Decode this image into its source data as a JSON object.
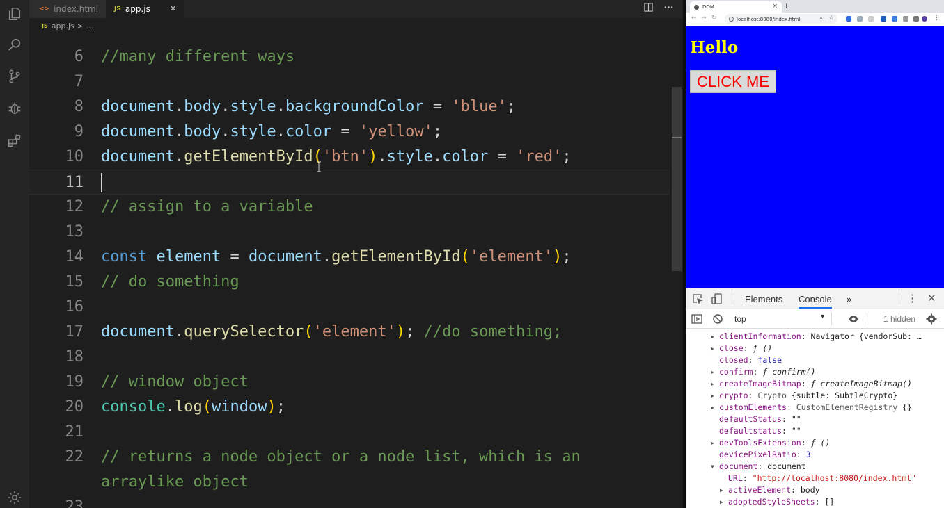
{
  "editor": {
    "tabs": [
      {
        "label": "index.html",
        "glyph": "<>"
      },
      {
        "label": "app.js",
        "glyph": "JS"
      }
    ],
    "tab_close": "×",
    "breadcrumb": {
      "glyph": "JS",
      "file": "app.js",
      "sep": ">",
      "rest": "..."
    },
    "lines": [
      {
        "num": "6",
        "tokens": [
          {
            "t": "//many different ways",
            "c": "comment"
          }
        ]
      },
      {
        "num": "7",
        "tokens": []
      },
      {
        "num": "8",
        "tokens": [
          {
            "t": "document",
            "c": "var"
          },
          {
            "t": ".",
            "c": "plain"
          },
          {
            "t": "body",
            "c": "var"
          },
          {
            "t": ".",
            "c": "plain"
          },
          {
            "t": "style",
            "c": "var"
          },
          {
            "t": ".",
            "c": "plain"
          },
          {
            "t": "backgroundColor",
            "c": "var"
          },
          {
            "t": " = ",
            "c": "plain"
          },
          {
            "t": "'blue'",
            "c": "str"
          },
          {
            "t": ";",
            "c": "plain"
          }
        ]
      },
      {
        "num": "9",
        "tokens": [
          {
            "t": "document",
            "c": "var"
          },
          {
            "t": ".",
            "c": "plain"
          },
          {
            "t": "body",
            "c": "var"
          },
          {
            "t": ".",
            "c": "plain"
          },
          {
            "t": "style",
            "c": "var"
          },
          {
            "t": ".",
            "c": "plain"
          },
          {
            "t": "color",
            "c": "var"
          },
          {
            "t": " = ",
            "c": "plain"
          },
          {
            "t": "'yellow'",
            "c": "str"
          },
          {
            "t": ";",
            "c": "plain"
          }
        ]
      },
      {
        "num": "10",
        "tokens": [
          {
            "t": "document",
            "c": "var"
          },
          {
            "t": ".",
            "c": "plain"
          },
          {
            "t": "getElementById",
            "c": "fn"
          },
          {
            "t": "(",
            "c": "brk"
          },
          {
            "t": "'btn'",
            "c": "str"
          },
          {
            "t": ")",
            "c": "brk"
          },
          {
            "t": ".",
            "c": "plain"
          },
          {
            "t": "style",
            "c": "var"
          },
          {
            "t": ".",
            "c": "plain"
          },
          {
            "t": "color",
            "c": "var"
          },
          {
            "t": " = ",
            "c": "plain"
          },
          {
            "t": "'red'",
            "c": "str"
          },
          {
            "t": ";",
            "c": "plain"
          }
        ]
      },
      {
        "num": "11",
        "tokens": [],
        "current": true
      },
      {
        "num": "12",
        "tokens": [
          {
            "t": "// assign to a variable",
            "c": "comment"
          }
        ]
      },
      {
        "num": "13",
        "tokens": []
      },
      {
        "num": "14",
        "tokens": [
          {
            "t": "const",
            "c": "kw"
          },
          {
            "t": " ",
            "c": "plain"
          },
          {
            "t": "element",
            "c": "var"
          },
          {
            "t": " = ",
            "c": "plain"
          },
          {
            "t": "document",
            "c": "var"
          },
          {
            "t": ".",
            "c": "plain"
          },
          {
            "t": "getElementById",
            "c": "fn"
          },
          {
            "t": "(",
            "c": "brk"
          },
          {
            "t": "'element'",
            "c": "str"
          },
          {
            "t": ")",
            "c": "brk"
          },
          {
            "t": ";",
            "c": "plain"
          }
        ]
      },
      {
        "num": "15",
        "tokens": [
          {
            "t": "// do something",
            "c": "comment"
          }
        ]
      },
      {
        "num": "16",
        "tokens": []
      },
      {
        "num": "17",
        "tokens": [
          {
            "t": "document",
            "c": "var"
          },
          {
            "t": ".",
            "c": "plain"
          },
          {
            "t": "querySelector",
            "c": "fn"
          },
          {
            "t": "(",
            "c": "brk"
          },
          {
            "t": "'element'",
            "c": "str"
          },
          {
            "t": ")",
            "c": "brk"
          },
          {
            "t": "; ",
            "c": "plain"
          },
          {
            "t": "//do something;",
            "c": "comment"
          }
        ]
      },
      {
        "num": "18",
        "tokens": []
      },
      {
        "num": "19",
        "tokens": [
          {
            "t": "// window object",
            "c": "comment"
          }
        ]
      },
      {
        "num": "20",
        "tokens": [
          {
            "t": "console",
            "c": "obj"
          },
          {
            "t": ".",
            "c": "plain"
          },
          {
            "t": "log",
            "c": "fn"
          },
          {
            "t": "(",
            "c": "brk"
          },
          {
            "t": "window",
            "c": "var"
          },
          {
            "t": ")",
            "c": "brk"
          },
          {
            "t": ";",
            "c": "plain"
          }
        ]
      },
      {
        "num": "21",
        "tokens": []
      },
      {
        "num": "22",
        "tokens": [
          {
            "t": "// returns a node object or a node list, which is an",
            "c": "comment"
          }
        ]
      },
      {
        "num": "",
        "tokens": [
          {
            "t": "arraylike object",
            "c": "comment"
          }
        ]
      },
      {
        "num": "23",
        "tokens": []
      }
    ],
    "colors": {
      "comment": "#6a9955",
      "var": "#9cdcfe",
      "fn": "#dcdcaa",
      "str": "#ce9178",
      "plain": "#d4d4d4",
      "kw": "#569cd6",
      "brk": "#ffd700",
      "obj": "#4ec9b0"
    }
  },
  "activity_icons": [
    "files-icon",
    "search-icon",
    "source-control-icon",
    "debug-icon",
    "extensions-icon",
    "settings-gear-icon"
  ],
  "browser": {
    "tab_title": "DOM",
    "tab_close": "×",
    "new_tab": "+",
    "url": "localhost:8080/index.html",
    "page": {
      "heading": "Hello",
      "button_label": "CLICK ME",
      "background": "#0000ff",
      "text_color": "#ffff00",
      "button_color": "#ff0000"
    }
  },
  "devtools": {
    "tabs": [
      "Elements",
      "Console"
    ],
    "active_tab": "Console",
    "more": "»",
    "context": "top",
    "hidden_count": "1 hidden",
    "entries": [
      {
        "indent": 0,
        "arrow": "right",
        "parts": [
          {
            "t": "clientInformation",
            "c": "k"
          },
          {
            "t": ": Navigator {vendorSub: …",
            "c": "p"
          }
        ]
      },
      {
        "indent": 0,
        "arrow": "right",
        "parts": [
          {
            "t": "close",
            "c": "k"
          },
          {
            "t": ": ",
            "c": "p"
          },
          {
            "t": "ƒ ()",
            "c": "i"
          }
        ]
      },
      {
        "indent": 0,
        "arrow": "none",
        "parts": [
          {
            "t": "closed",
            "c": "k"
          },
          {
            "t": ": ",
            "c": "p"
          },
          {
            "t": "false",
            "c": "v"
          }
        ]
      },
      {
        "indent": 0,
        "arrow": "right",
        "parts": [
          {
            "t": "confirm",
            "c": "k"
          },
          {
            "t": ": ",
            "c": "p"
          },
          {
            "t": "ƒ confirm()",
            "c": "i"
          }
        ]
      },
      {
        "indent": 0,
        "arrow": "right",
        "parts": [
          {
            "t": "createImageBitmap",
            "c": "k"
          },
          {
            "t": ": ",
            "c": "p"
          },
          {
            "t": "ƒ createImageBitmap()",
            "c": "i"
          }
        ]
      },
      {
        "indent": 0,
        "arrow": "right",
        "parts": [
          {
            "t": "crypto",
            "c": "k"
          },
          {
            "t": ": Crypto ",
            "c": "g"
          },
          {
            "t": "{subtle: SubtleCrypto}",
            "c": "p"
          }
        ]
      },
      {
        "indent": 0,
        "arrow": "right",
        "parts": [
          {
            "t": "customElements",
            "c": "k"
          },
          {
            "t": ": CustomElementRegistry ",
            "c": "g"
          },
          {
            "t": "{}",
            "c": "p"
          }
        ]
      },
      {
        "indent": 0,
        "arrow": "none",
        "parts": [
          {
            "t": "defaultStatus",
            "c": "k"
          },
          {
            "t": ": \"\"",
            "c": "p"
          }
        ]
      },
      {
        "indent": 0,
        "arrow": "none",
        "parts": [
          {
            "t": "defaultstatus",
            "c": "k"
          },
          {
            "t": ": \"\"",
            "c": "p"
          }
        ]
      },
      {
        "indent": 0,
        "arrow": "right",
        "parts": [
          {
            "t": "devToolsExtension",
            "c": "k"
          },
          {
            "t": ": ",
            "c": "p"
          },
          {
            "t": "ƒ ()",
            "c": "i"
          }
        ]
      },
      {
        "indent": 0,
        "arrow": "none",
        "parts": [
          {
            "t": "devicePixelRatio",
            "c": "k"
          },
          {
            "t": ": ",
            "c": "p"
          },
          {
            "t": "3",
            "c": "v"
          }
        ]
      },
      {
        "indent": 0,
        "arrow": "down",
        "parts": [
          {
            "t": "document",
            "c": "k"
          },
          {
            "t": ": document",
            "c": "p"
          }
        ]
      },
      {
        "indent": 1,
        "arrow": "none",
        "parts": [
          {
            "t": "URL",
            "c": "k"
          },
          {
            "t": ": ",
            "c": "p"
          },
          {
            "t": "\"http://localhost:8080/index.html\"",
            "c": "s"
          }
        ]
      },
      {
        "indent": 1,
        "arrow": "right",
        "parts": [
          {
            "t": "activeElement",
            "c": "k"
          },
          {
            "t": ": body",
            "c": "p"
          }
        ]
      },
      {
        "indent": 1,
        "arrow": "right",
        "parts": [
          {
            "t": "adoptedStyleSheets",
            "c": "k"
          },
          {
            "t": ": []",
            "c": "p"
          }
        ]
      }
    ]
  }
}
